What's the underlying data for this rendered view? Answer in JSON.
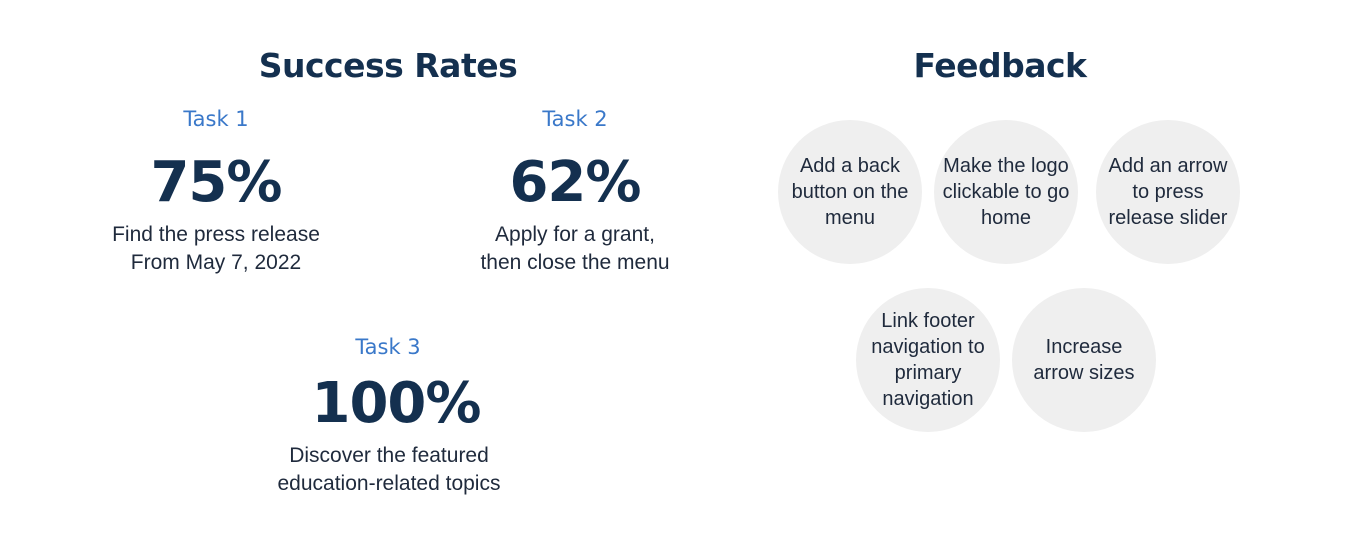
{
  "success_rates": {
    "title": "Success Rates",
    "tasks": [
      {
        "label": "Task 1",
        "percent": "75%",
        "desc_line1": "Find the press release",
        "desc_line2": "From May 7, 2022"
      },
      {
        "label": "Task 2",
        "percent": "62%",
        "desc_line1": "Apply for a grant,",
        "desc_line2": "then close the menu"
      },
      {
        "label": "Task 3",
        "percent": "100%",
        "desc_line1": "Discover the featured",
        "desc_line2": "education-related topics"
      }
    ]
  },
  "feedback": {
    "title": "Feedback",
    "items": [
      "Add a back button on the menu",
      "Make the logo clickable to go home",
      "Add an arrow to press release slider",
      "Link footer navigation to primary navigation",
      "Increase arrow sizes"
    ]
  }
}
